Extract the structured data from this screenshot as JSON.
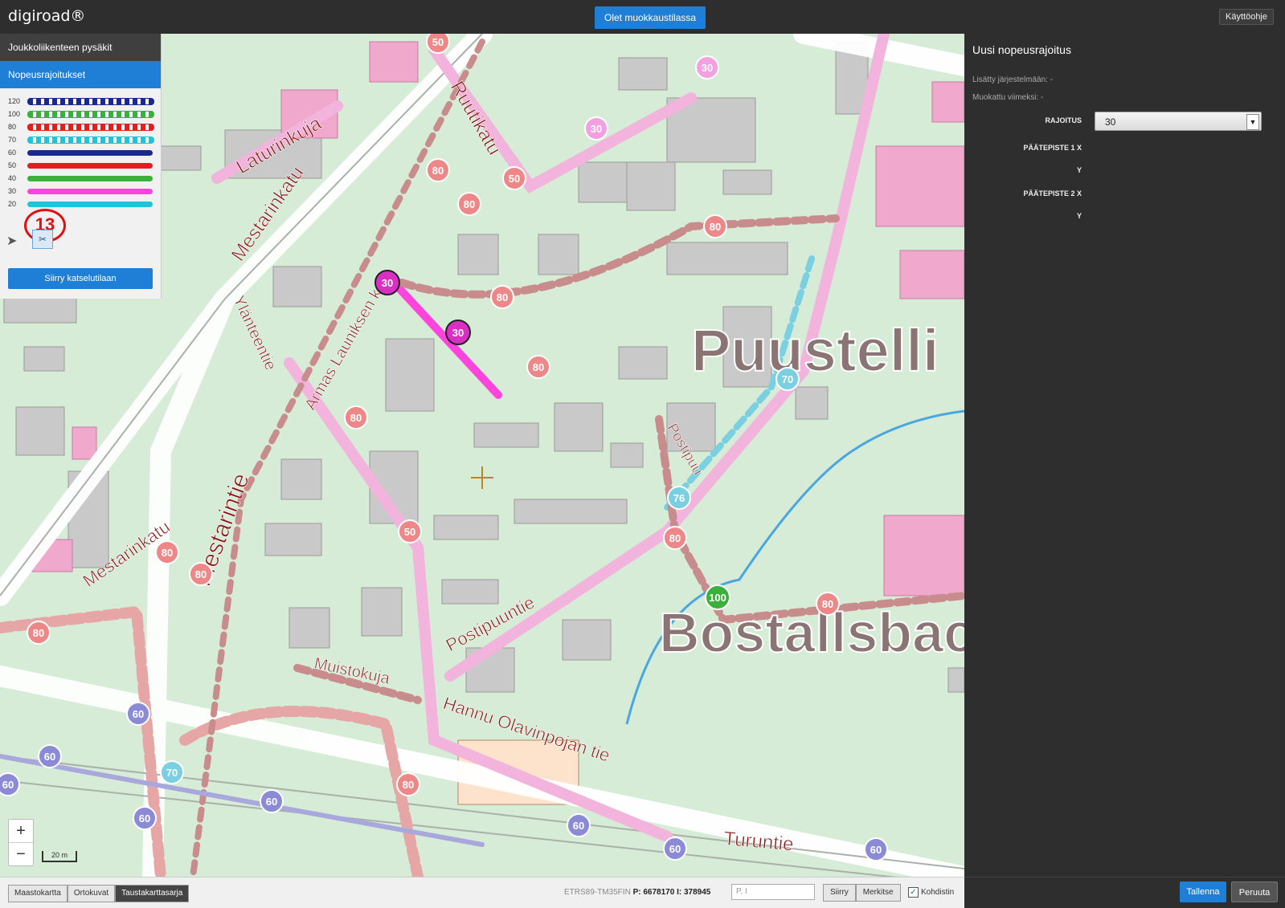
{
  "app": {
    "logo": "digiroad®",
    "mode_banner": "Olet muokkaustilassa",
    "help_button": "Käyttöohje"
  },
  "left_panel": {
    "tabs": [
      {
        "label": "Joukkoliikenteen pysäkit"
      },
      {
        "label": "Nopeusrajoitukset"
      }
    ],
    "legend": [
      {
        "value": "120",
        "color": "#1a2a8c",
        "dashed": true
      },
      {
        "value": "100",
        "color": "#3bb03b",
        "dashed": true
      },
      {
        "value": "80",
        "color": "#e02020",
        "dashed": true
      },
      {
        "value": "70",
        "color": "#1fc4d8",
        "dashed": true
      },
      {
        "value": "60",
        "color": "#1a2a8c",
        "dashed": false
      },
      {
        "value": "50",
        "color": "#e02020",
        "dashed": false
      },
      {
        "value": "40",
        "color": "#3bb03b",
        "dashed": false
      },
      {
        "value": "30",
        "color": "#ff44dd",
        "dashed": false
      },
      {
        "value": "20",
        "color": "#1fc4d8",
        "dashed": false
      }
    ],
    "zoom_level": "13",
    "view_mode_button": "Siirry katselutilaan"
  },
  "map": {
    "street_names": [
      "Laturinkuja",
      "Mestarinkatu",
      "Ruutikatu",
      "Ylänteentie",
      "Armas Launiksen katu",
      "Mestarintie",
      "Postipuuntie",
      "Muistokuja",
      "Hannu Olavinpojan tie",
      "Turuntie",
      "Postipuu",
      "Mestarinkatu"
    ],
    "area_names": [
      "Puustelli",
      "Bostallsbac"
    ],
    "speed_signs": [
      "50",
      "30",
      "30",
      "80",
      "50",
      "80",
      "30",
      "30",
      "80",
      "80",
      "80",
      "70",
      "76",
      "80",
      "100",
      "80",
      "50",
      "60",
      "60",
      "80",
      "80",
      "60",
      "60",
      "70",
      "60",
      "60",
      "60",
      "80",
      "80",
      "80",
      "60"
    ],
    "scale_label": "20 m"
  },
  "right_panel": {
    "title": "Uusi nopeusrajoitus",
    "added_label": "Lisätty järjestelmään: -",
    "modified_label": "Muokattu viimeksi: -",
    "limit_label": "RAJOITUS",
    "limit_value": "30",
    "endpoint1_x_label": "PÄÄTEPISTE 1 X",
    "endpoint1_y_label": "Y",
    "endpoint2_x_label": "PÄÄTEPISTE 2 X",
    "endpoint2_y_label": "Y",
    "save_button": "Tallenna",
    "cancel_button": "Peruuta"
  },
  "bottom_bar": {
    "layers": [
      {
        "label": "Maastokartta",
        "active": false
      },
      {
        "label": "Ortokuvat",
        "active": false
      },
      {
        "label": "Taustakarttasarja",
        "active": true
      }
    ],
    "projection": "ETRS89-TM35FIN",
    "p_label": "P:",
    "p_value": "6678170",
    "i_label": "I:",
    "i_value": "378945",
    "coord_placeholder": "P, I",
    "move_button": "Siirry",
    "mark_button": "Merkitse",
    "crosshair_label": "Kohdistin",
    "crosshair_checked": true
  }
}
